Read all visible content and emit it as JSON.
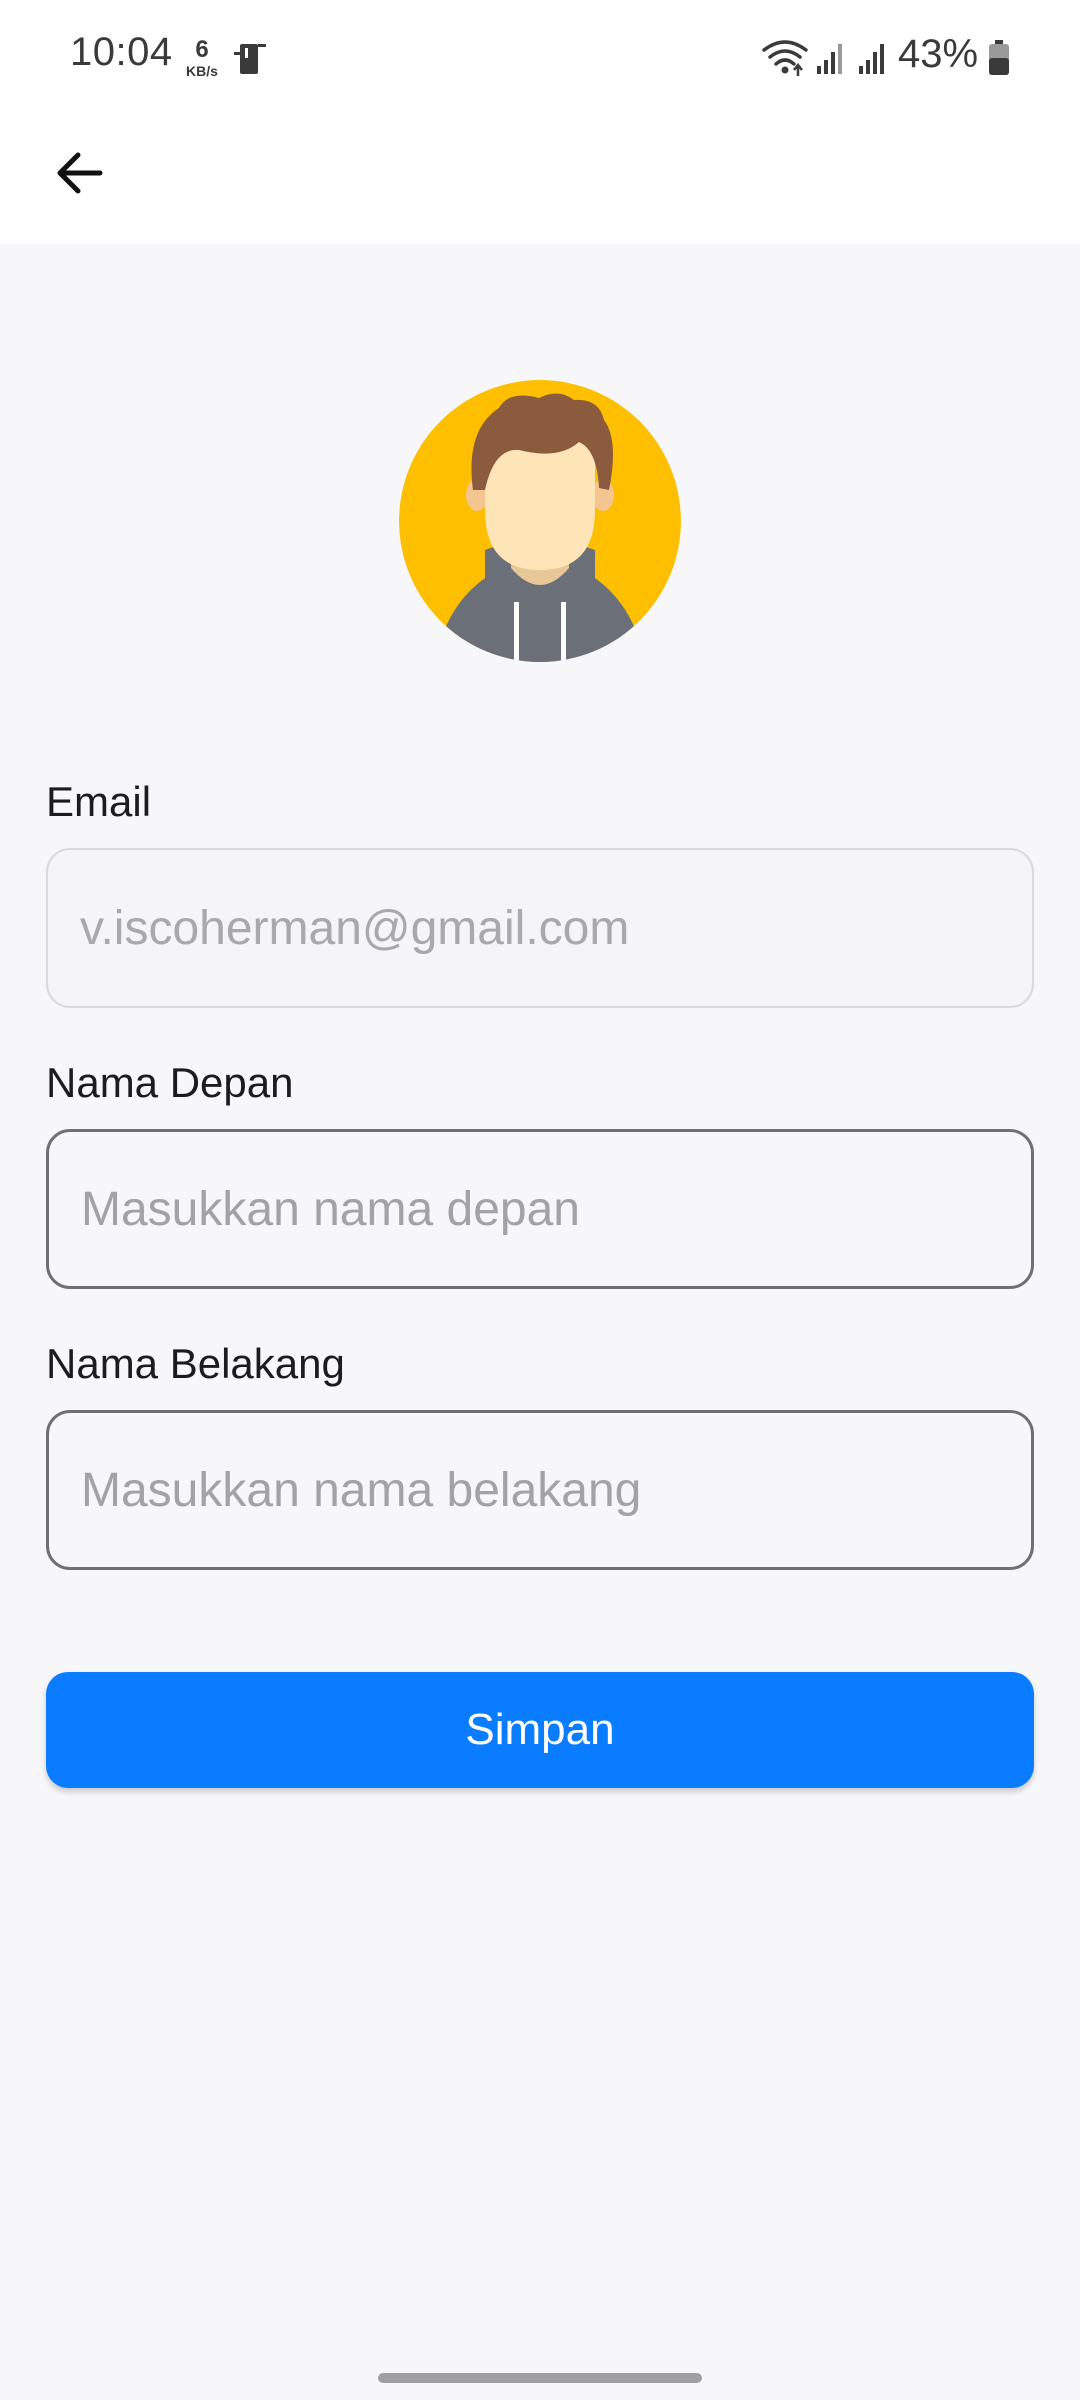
{
  "status_bar": {
    "time": "10:04",
    "net_speed_value": "6",
    "net_speed_unit": "KB/s",
    "battery_percent": "43%",
    "icons": [
      "sim-icon",
      "wifi-icon",
      "signal-icon",
      "signal-icon",
      "battery-icon"
    ]
  },
  "app_bar": {
    "back_icon": "arrow-left-icon"
  },
  "profile": {
    "avatar_icon": "user-avatar",
    "avatar_bg_color": "#FDBF00"
  },
  "form": {
    "email_label": "Email",
    "email_value": "v.iscoherman@gmail.com",
    "first_name_label": "Nama Depan",
    "first_name_placeholder": "Masukkan nama depan",
    "last_name_label": "Nama Belakang",
    "last_name_placeholder": "Masukkan nama belakang",
    "save_label": "Simpan"
  },
  "colors": {
    "primary": "#0A7CFF",
    "background": "#F7F7FA"
  }
}
